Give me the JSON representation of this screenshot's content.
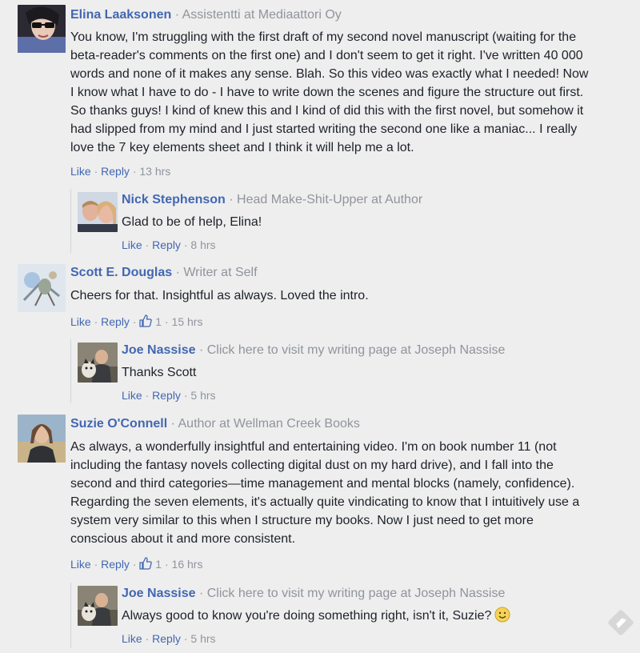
{
  "comments": [
    {
      "author": "Elina Laaksonen",
      "title": "Assistentti at Mediaattori Oy",
      "text_lines": [
        "You know, I'm struggling with the first draft of my second novel manuscript (waiting for the",
        "beta-reader's comments on the first one) and I don't seem to get it right. I've written 40 000",
        "words and none of it makes any sense. Blah. So this video was exactly what I needed! Now",
        "I know what I have to do - I have to write down the scenes and figure the structure out first.",
        "So thanks guys! I kind of knew this and I kind of did this with the first novel, but somehow it",
        "had slipped from my mind and I just started writing the second one like a maniac... I really",
        "love the 7 key elements sheet and I think it will help me a lot."
      ],
      "like": "Like",
      "reply": "Reply",
      "time": "13 hrs",
      "reply_item": {
        "author": "Nick Stephenson",
        "title": "Head Make-Shit-Upper at Author",
        "text": "Glad to be of help, Elina!",
        "like": "Like",
        "reply": "Reply",
        "time": "8 hrs"
      }
    },
    {
      "author": "Scott E. Douglas",
      "title": "Writer at Self",
      "text_lines": [
        "Cheers for that. Insightful as always. Loved the intro."
      ],
      "like": "Like",
      "reply": "Reply",
      "like_count": "1",
      "time": "15 hrs",
      "reply_item": {
        "author": "Joe Nassise",
        "title": "Click here to visit my writing page at Joseph Nassise",
        "text": "Thanks Scott",
        "like": "Like",
        "reply": "Reply",
        "time": "5 hrs"
      }
    },
    {
      "author": "Suzie O'Connell",
      "title": "Author at Wellman Creek Books",
      "text_lines": [
        "As always, a wonderfully insightful and entertaining video. I'm on book number 11 (not",
        "including the fantasy novels collecting digital dust on my hard drive), and I fall into the",
        "second and third categories—time management and mental blocks (namely, confidence).",
        "Regarding the seven elements, it's actually quite vindicating to know that I intuitively use a",
        "system very similar to this when I structure my books. Now I just need to get more",
        "conscious about it and more consistent."
      ],
      "like": "Like",
      "reply": "Reply",
      "like_count": "1",
      "time": "16 hrs",
      "reply_item": {
        "author": "Joe Nassise",
        "title": "Click here to visit my writing page at Joseph Nassise",
        "text": "Always good to know you're doing something right, isn't it, Suzie?",
        "like": "Like",
        "reply": "Reply",
        "time": "5 hrs"
      }
    }
  ],
  "separator": "·",
  "colors": {
    "link": "#4267b2",
    "meta": "#90949c",
    "text": "#1d2129",
    "background": "#eeeeee"
  },
  "icons": [
    "thumbs-up-icon",
    "smiley-emoji-icon",
    "comment-plugin-logo-icon"
  ]
}
